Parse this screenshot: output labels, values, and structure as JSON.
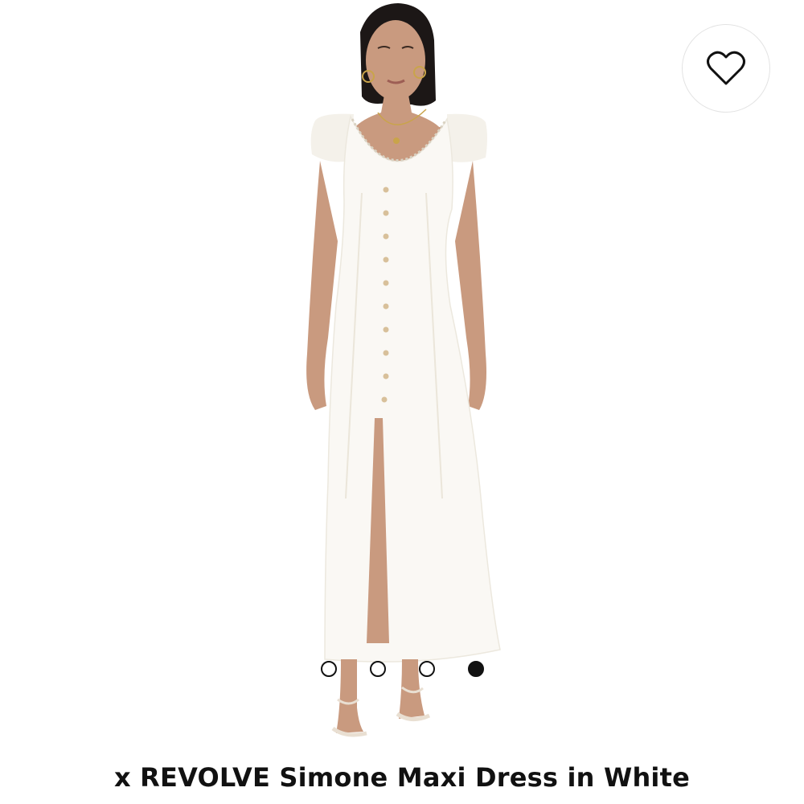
{
  "product": {
    "title": "x REVOLVE Simone Maxi Dress in White",
    "image_alt": "Model wearing white button-front maxi dress"
  },
  "favorite": {
    "icon": "heart-outline-icon"
  },
  "carousel": {
    "total": 4,
    "active_index": 3
  },
  "colors": {
    "text": "#111111",
    "background": "#ffffff",
    "dress": "#faf8f4"
  }
}
